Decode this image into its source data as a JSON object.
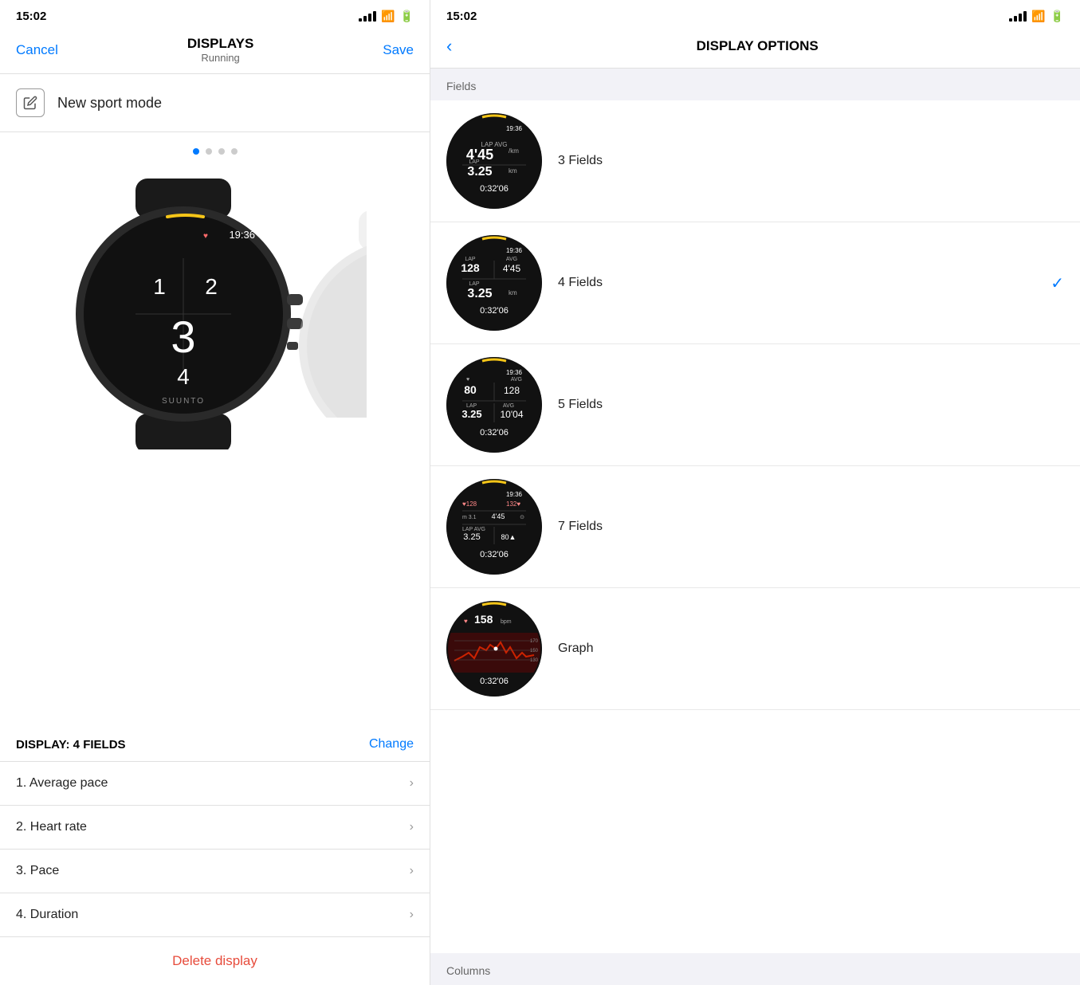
{
  "left": {
    "status_time": "15:02",
    "nav": {
      "cancel": "Cancel",
      "title": "DISPLAYS",
      "subtitle": "Running",
      "save": "Save"
    },
    "sport_mode": "New sport mode",
    "dots": [
      "active",
      "inactive",
      "inactive",
      "inactive"
    ],
    "display_fields_title": "DISPLAY: 4 FIELDS",
    "change_label": "Change",
    "fields": [
      {
        "number": "1.",
        "label": "Average pace"
      },
      {
        "number": "2.",
        "label": "Heart rate"
      },
      {
        "number": "3.",
        "label": "Pace"
      },
      {
        "number": "4.",
        "label": "Duration"
      }
    ],
    "delete_label": "Delete display"
  },
  "right": {
    "status_time": "15:02",
    "nav_title": "DISPLAY OPTIONS",
    "back_label": "<",
    "sections": {
      "fields_label": "Fields",
      "columns_label": "Columns"
    },
    "options": [
      {
        "label": "3 Fields",
        "selected": false
      },
      {
        "label": "4 Fields",
        "selected": true
      },
      {
        "label": "5 Fields",
        "selected": false
      },
      {
        "label": "7 Fields",
        "selected": false
      },
      {
        "label": "Graph",
        "selected": false
      }
    ]
  }
}
